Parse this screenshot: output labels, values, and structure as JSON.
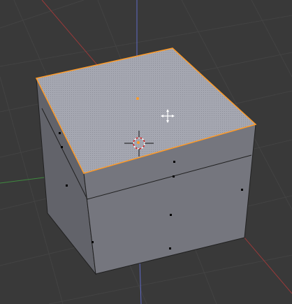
{
  "viewport": {
    "name": "3D View",
    "background": "#393939",
    "grid_color": "#434343",
    "axis_x_color": "#9a3a3a",
    "axis_y_color": "#3f8a3f",
    "axis_z_color": "#5f69c4"
  },
  "cube": {
    "selected_face": "top",
    "face_top_color": "#a4a6b0",
    "face_front_color": "#7c7d85",
    "face_right_color": "#6e6f77",
    "face_left_color": "#63646b",
    "edge_color": "#202020",
    "selected_edge_color": "#ff9b28",
    "loop_cut": true
  },
  "cursor": {
    "icon": "3d-cursor-icon",
    "mouse_icon": "move-crosshair-icon"
  }
}
